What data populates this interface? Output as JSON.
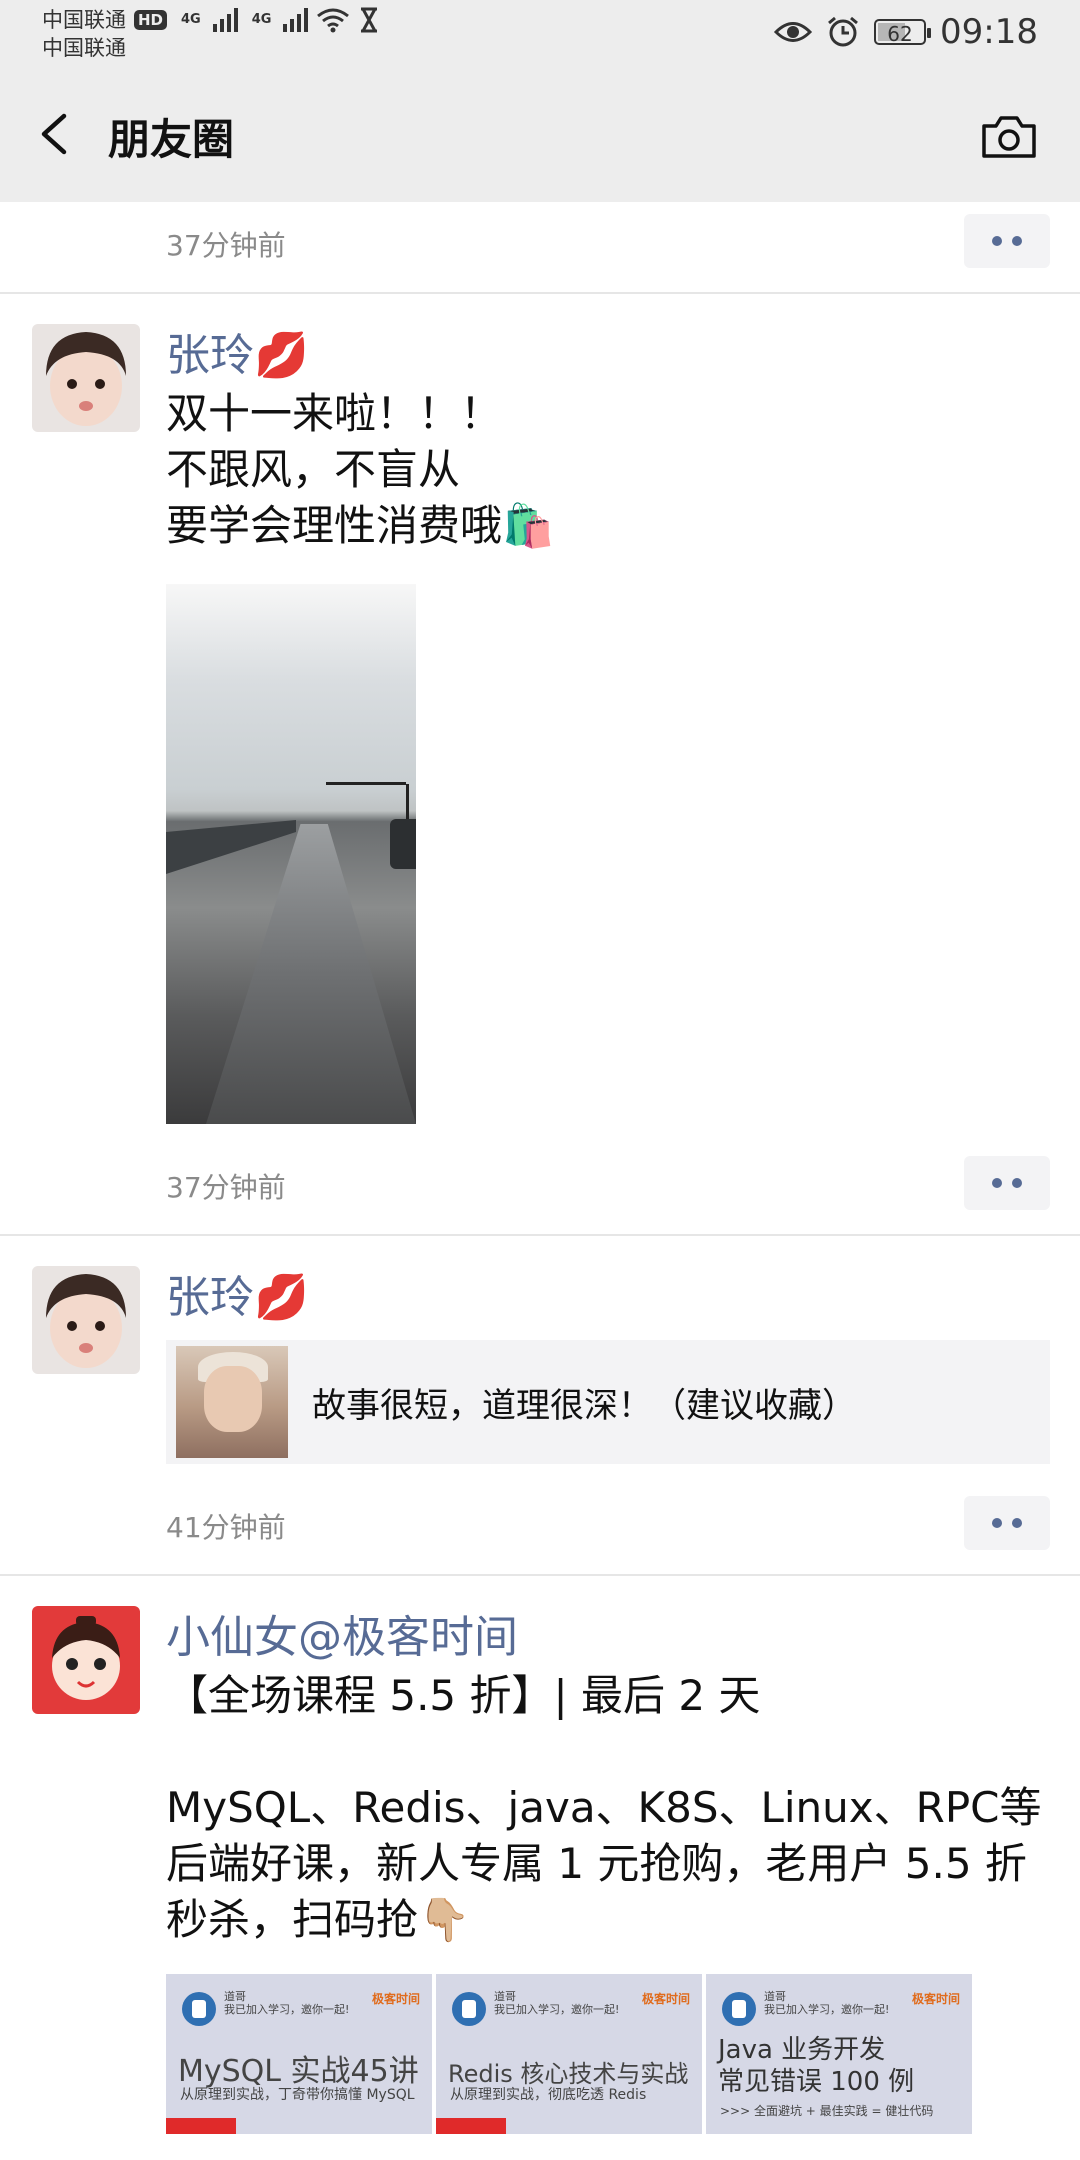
{
  "status_bar": {
    "carrier1": "中国联通",
    "carrier2": "中国联通",
    "hd_badge": "HD",
    "network1": "4G",
    "network2": "4G",
    "battery": "62",
    "battery_level": 0.62,
    "time": "09:18"
  },
  "navbar": {
    "title": "朋友圈"
  },
  "feed": {
    "top_partial": {
      "time": "37分钟前"
    },
    "posts": [
      {
        "name": "张玲💋",
        "text": "双十一来啦！！！\n不跟风，不盲从\n要学会理性消费哦🛍️",
        "time": "37分钟前"
      },
      {
        "name": "张玲💋",
        "link_title": "故事很短，道理很深！（建议收藏）",
        "time": "41分钟前"
      },
      {
        "name": "小仙女@极客时间",
        "text": "【全场课程 5.5 折】| 最后 2 天\n\nMySQL、Redis、java、K8S、Linux、RPC等后端好课，新人专属 1 元抢购，老用户 5.5 折秒杀，扫码抢👇🏼",
        "thumbs": [
          {
            "small": "道哥\n我已加入学习，邀你一起!",
            "brand": "极客时间",
            "title": "MySQL 实战45讲",
            "sub": "从原理到实战，丁奇带你搞懂 MySQL"
          },
          {
            "small": "道哥\n我已加入学习，邀你一起!",
            "brand": "极客时间",
            "title": "Redis 核心技术与实战",
            "sub": "从原理到实战，彻底吃透 Redis"
          },
          {
            "small": "道哥\n我已加入学习，邀你一起!",
            "brand": "极客时间",
            "title": "Java 业务开发\n常见错误 100 例",
            "sub": ">>> 全面避坑 + 最佳实践 = 健壮代码"
          }
        ]
      }
    ]
  },
  "colors": {
    "link_blue": "#576b95",
    "bar_bg": "#ededed"
  }
}
